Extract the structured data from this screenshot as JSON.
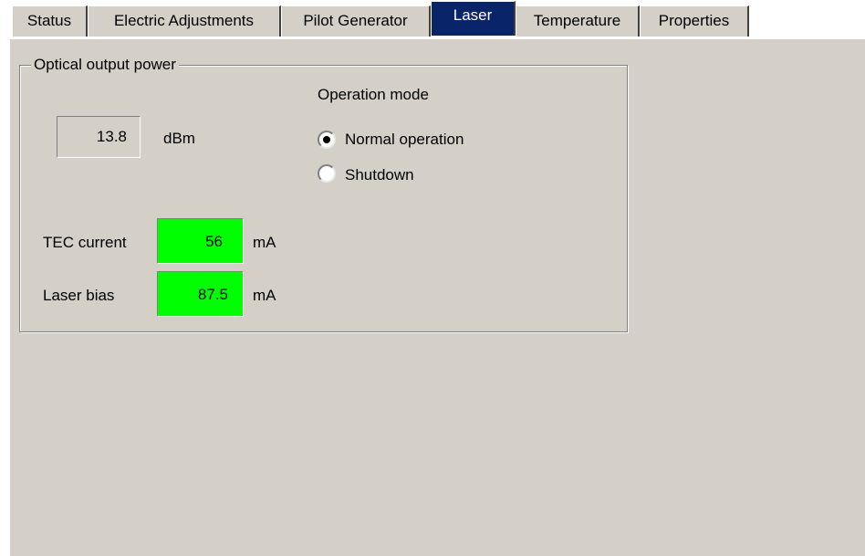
{
  "tabs": [
    {
      "label": "Status"
    },
    {
      "label": "Electric Adjustments"
    },
    {
      "label": "Pilot Generator"
    },
    {
      "label": "Laser"
    },
    {
      "label": "Temperature"
    },
    {
      "label": "Properties"
    }
  ],
  "active_tab": "Laser",
  "group": {
    "title": "Optical output power"
  },
  "output_power": {
    "value": "13.8",
    "unit": "dBm"
  },
  "operation_mode": {
    "title": "Operation mode",
    "options": [
      {
        "label": "Normal operation",
        "selected": true
      },
      {
        "label": "Shutdown",
        "selected": false
      }
    ]
  },
  "tec_current": {
    "label": "TEC current",
    "value": "56",
    "unit": "mA"
  },
  "laser_bias": {
    "label": "Laser bias",
    "value": "87.5",
    "unit": "mA"
  },
  "colors": {
    "panel_bg": "#d4d0c8",
    "active_tab_bg": "#0a246a",
    "ok_field": "#00ff00"
  }
}
